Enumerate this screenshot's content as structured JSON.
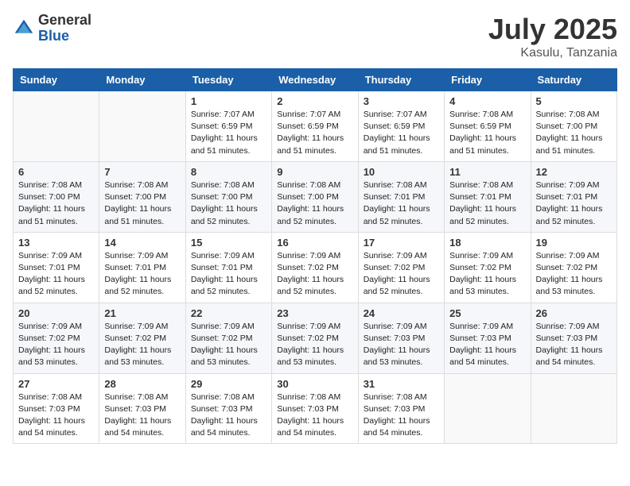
{
  "logo": {
    "general": "General",
    "blue": "Blue"
  },
  "title": "July 2025",
  "subtitle": "Kasulu, Tanzania",
  "days_header": [
    "Sunday",
    "Monday",
    "Tuesday",
    "Wednesday",
    "Thursday",
    "Friday",
    "Saturday"
  ],
  "weeks": [
    [
      {
        "day": "",
        "info": ""
      },
      {
        "day": "",
        "info": ""
      },
      {
        "day": "1",
        "info": "Sunrise: 7:07 AM\nSunset: 6:59 PM\nDaylight: 11 hours and 51 minutes."
      },
      {
        "day": "2",
        "info": "Sunrise: 7:07 AM\nSunset: 6:59 PM\nDaylight: 11 hours and 51 minutes."
      },
      {
        "day": "3",
        "info": "Sunrise: 7:07 AM\nSunset: 6:59 PM\nDaylight: 11 hours and 51 minutes."
      },
      {
        "day": "4",
        "info": "Sunrise: 7:08 AM\nSunset: 6:59 PM\nDaylight: 11 hours and 51 minutes."
      },
      {
        "day": "5",
        "info": "Sunrise: 7:08 AM\nSunset: 7:00 PM\nDaylight: 11 hours and 51 minutes."
      }
    ],
    [
      {
        "day": "6",
        "info": "Sunrise: 7:08 AM\nSunset: 7:00 PM\nDaylight: 11 hours and 51 minutes."
      },
      {
        "day": "7",
        "info": "Sunrise: 7:08 AM\nSunset: 7:00 PM\nDaylight: 11 hours and 51 minutes."
      },
      {
        "day": "8",
        "info": "Sunrise: 7:08 AM\nSunset: 7:00 PM\nDaylight: 11 hours and 52 minutes."
      },
      {
        "day": "9",
        "info": "Sunrise: 7:08 AM\nSunset: 7:00 PM\nDaylight: 11 hours and 52 minutes."
      },
      {
        "day": "10",
        "info": "Sunrise: 7:08 AM\nSunset: 7:01 PM\nDaylight: 11 hours and 52 minutes."
      },
      {
        "day": "11",
        "info": "Sunrise: 7:08 AM\nSunset: 7:01 PM\nDaylight: 11 hours and 52 minutes."
      },
      {
        "day": "12",
        "info": "Sunrise: 7:09 AM\nSunset: 7:01 PM\nDaylight: 11 hours and 52 minutes."
      }
    ],
    [
      {
        "day": "13",
        "info": "Sunrise: 7:09 AM\nSunset: 7:01 PM\nDaylight: 11 hours and 52 minutes."
      },
      {
        "day": "14",
        "info": "Sunrise: 7:09 AM\nSunset: 7:01 PM\nDaylight: 11 hours and 52 minutes."
      },
      {
        "day": "15",
        "info": "Sunrise: 7:09 AM\nSunset: 7:01 PM\nDaylight: 11 hours and 52 minutes."
      },
      {
        "day": "16",
        "info": "Sunrise: 7:09 AM\nSunset: 7:02 PM\nDaylight: 11 hours and 52 minutes."
      },
      {
        "day": "17",
        "info": "Sunrise: 7:09 AM\nSunset: 7:02 PM\nDaylight: 11 hours and 52 minutes."
      },
      {
        "day": "18",
        "info": "Sunrise: 7:09 AM\nSunset: 7:02 PM\nDaylight: 11 hours and 53 minutes."
      },
      {
        "day": "19",
        "info": "Sunrise: 7:09 AM\nSunset: 7:02 PM\nDaylight: 11 hours and 53 minutes."
      }
    ],
    [
      {
        "day": "20",
        "info": "Sunrise: 7:09 AM\nSunset: 7:02 PM\nDaylight: 11 hours and 53 minutes."
      },
      {
        "day": "21",
        "info": "Sunrise: 7:09 AM\nSunset: 7:02 PM\nDaylight: 11 hours and 53 minutes."
      },
      {
        "day": "22",
        "info": "Sunrise: 7:09 AM\nSunset: 7:02 PM\nDaylight: 11 hours and 53 minutes."
      },
      {
        "day": "23",
        "info": "Sunrise: 7:09 AM\nSunset: 7:02 PM\nDaylight: 11 hours and 53 minutes."
      },
      {
        "day": "24",
        "info": "Sunrise: 7:09 AM\nSunset: 7:03 PM\nDaylight: 11 hours and 53 minutes."
      },
      {
        "day": "25",
        "info": "Sunrise: 7:09 AM\nSunset: 7:03 PM\nDaylight: 11 hours and 54 minutes."
      },
      {
        "day": "26",
        "info": "Sunrise: 7:09 AM\nSunset: 7:03 PM\nDaylight: 11 hours and 54 minutes."
      }
    ],
    [
      {
        "day": "27",
        "info": "Sunrise: 7:08 AM\nSunset: 7:03 PM\nDaylight: 11 hours and 54 minutes."
      },
      {
        "day": "28",
        "info": "Sunrise: 7:08 AM\nSunset: 7:03 PM\nDaylight: 11 hours and 54 minutes."
      },
      {
        "day": "29",
        "info": "Sunrise: 7:08 AM\nSunset: 7:03 PM\nDaylight: 11 hours and 54 minutes."
      },
      {
        "day": "30",
        "info": "Sunrise: 7:08 AM\nSunset: 7:03 PM\nDaylight: 11 hours and 54 minutes."
      },
      {
        "day": "31",
        "info": "Sunrise: 7:08 AM\nSunset: 7:03 PM\nDaylight: 11 hours and 54 minutes."
      },
      {
        "day": "",
        "info": ""
      },
      {
        "day": "",
        "info": ""
      }
    ]
  ]
}
